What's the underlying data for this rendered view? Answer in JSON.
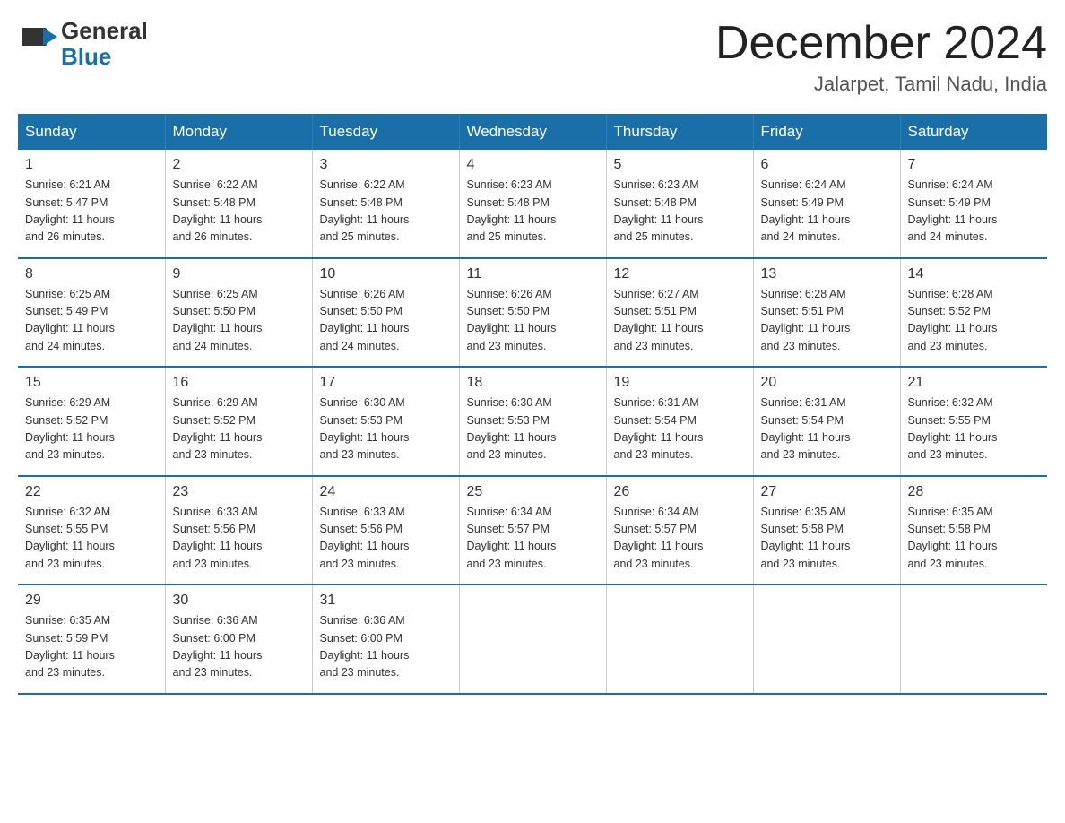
{
  "header": {
    "logo": {
      "general": "General",
      "blue": "Blue",
      "alt": "GeneralBlue Logo"
    },
    "title": "December 2024",
    "location": "Jalarpet, Tamil Nadu, India"
  },
  "weekdays": [
    "Sunday",
    "Monday",
    "Tuesday",
    "Wednesday",
    "Thursday",
    "Friday",
    "Saturday"
  ],
  "weeks": [
    [
      {
        "day": "1",
        "sunrise": "6:21 AM",
        "sunset": "5:47 PM",
        "daylight": "11 hours and 26 minutes."
      },
      {
        "day": "2",
        "sunrise": "6:22 AM",
        "sunset": "5:48 PM",
        "daylight": "11 hours and 26 minutes."
      },
      {
        "day": "3",
        "sunrise": "6:22 AM",
        "sunset": "5:48 PM",
        "daylight": "11 hours and 25 minutes."
      },
      {
        "day": "4",
        "sunrise": "6:23 AM",
        "sunset": "5:48 PM",
        "daylight": "11 hours and 25 minutes."
      },
      {
        "day": "5",
        "sunrise": "6:23 AM",
        "sunset": "5:48 PM",
        "daylight": "11 hours and 25 minutes."
      },
      {
        "day": "6",
        "sunrise": "6:24 AM",
        "sunset": "5:49 PM",
        "daylight": "11 hours and 24 minutes."
      },
      {
        "day": "7",
        "sunrise": "6:24 AM",
        "sunset": "5:49 PM",
        "daylight": "11 hours and 24 minutes."
      }
    ],
    [
      {
        "day": "8",
        "sunrise": "6:25 AM",
        "sunset": "5:49 PM",
        "daylight": "11 hours and 24 minutes."
      },
      {
        "day": "9",
        "sunrise": "6:25 AM",
        "sunset": "5:50 PM",
        "daylight": "11 hours and 24 minutes."
      },
      {
        "day": "10",
        "sunrise": "6:26 AM",
        "sunset": "5:50 PM",
        "daylight": "11 hours and 24 minutes."
      },
      {
        "day": "11",
        "sunrise": "6:26 AM",
        "sunset": "5:50 PM",
        "daylight": "11 hours and 23 minutes."
      },
      {
        "day": "12",
        "sunrise": "6:27 AM",
        "sunset": "5:51 PM",
        "daylight": "11 hours and 23 minutes."
      },
      {
        "day": "13",
        "sunrise": "6:28 AM",
        "sunset": "5:51 PM",
        "daylight": "11 hours and 23 minutes."
      },
      {
        "day": "14",
        "sunrise": "6:28 AM",
        "sunset": "5:52 PM",
        "daylight": "11 hours and 23 minutes."
      }
    ],
    [
      {
        "day": "15",
        "sunrise": "6:29 AM",
        "sunset": "5:52 PM",
        "daylight": "11 hours and 23 minutes."
      },
      {
        "day": "16",
        "sunrise": "6:29 AM",
        "sunset": "5:52 PM",
        "daylight": "11 hours and 23 minutes."
      },
      {
        "day": "17",
        "sunrise": "6:30 AM",
        "sunset": "5:53 PM",
        "daylight": "11 hours and 23 minutes."
      },
      {
        "day": "18",
        "sunrise": "6:30 AM",
        "sunset": "5:53 PM",
        "daylight": "11 hours and 23 minutes."
      },
      {
        "day": "19",
        "sunrise": "6:31 AM",
        "sunset": "5:54 PM",
        "daylight": "11 hours and 23 minutes."
      },
      {
        "day": "20",
        "sunrise": "6:31 AM",
        "sunset": "5:54 PM",
        "daylight": "11 hours and 23 minutes."
      },
      {
        "day": "21",
        "sunrise": "6:32 AM",
        "sunset": "5:55 PM",
        "daylight": "11 hours and 23 minutes."
      }
    ],
    [
      {
        "day": "22",
        "sunrise": "6:32 AM",
        "sunset": "5:55 PM",
        "daylight": "11 hours and 23 minutes."
      },
      {
        "day": "23",
        "sunrise": "6:33 AM",
        "sunset": "5:56 PM",
        "daylight": "11 hours and 23 minutes."
      },
      {
        "day": "24",
        "sunrise": "6:33 AM",
        "sunset": "5:56 PM",
        "daylight": "11 hours and 23 minutes."
      },
      {
        "day": "25",
        "sunrise": "6:34 AM",
        "sunset": "5:57 PM",
        "daylight": "11 hours and 23 minutes."
      },
      {
        "day": "26",
        "sunrise": "6:34 AM",
        "sunset": "5:57 PM",
        "daylight": "11 hours and 23 minutes."
      },
      {
        "day": "27",
        "sunrise": "6:35 AM",
        "sunset": "5:58 PM",
        "daylight": "11 hours and 23 minutes."
      },
      {
        "day": "28",
        "sunrise": "6:35 AM",
        "sunset": "5:58 PM",
        "daylight": "11 hours and 23 minutes."
      }
    ],
    [
      {
        "day": "29",
        "sunrise": "6:35 AM",
        "sunset": "5:59 PM",
        "daylight": "11 hours and 23 minutes."
      },
      {
        "day": "30",
        "sunrise": "6:36 AM",
        "sunset": "6:00 PM",
        "daylight": "11 hours and 23 minutes."
      },
      {
        "day": "31",
        "sunrise": "6:36 AM",
        "sunset": "6:00 PM",
        "daylight": "11 hours and 23 minutes."
      },
      null,
      null,
      null,
      null
    ]
  ],
  "labels": {
    "sunrise": "Sunrise: ",
    "sunset": "Sunset: ",
    "daylight": "Daylight: "
  }
}
